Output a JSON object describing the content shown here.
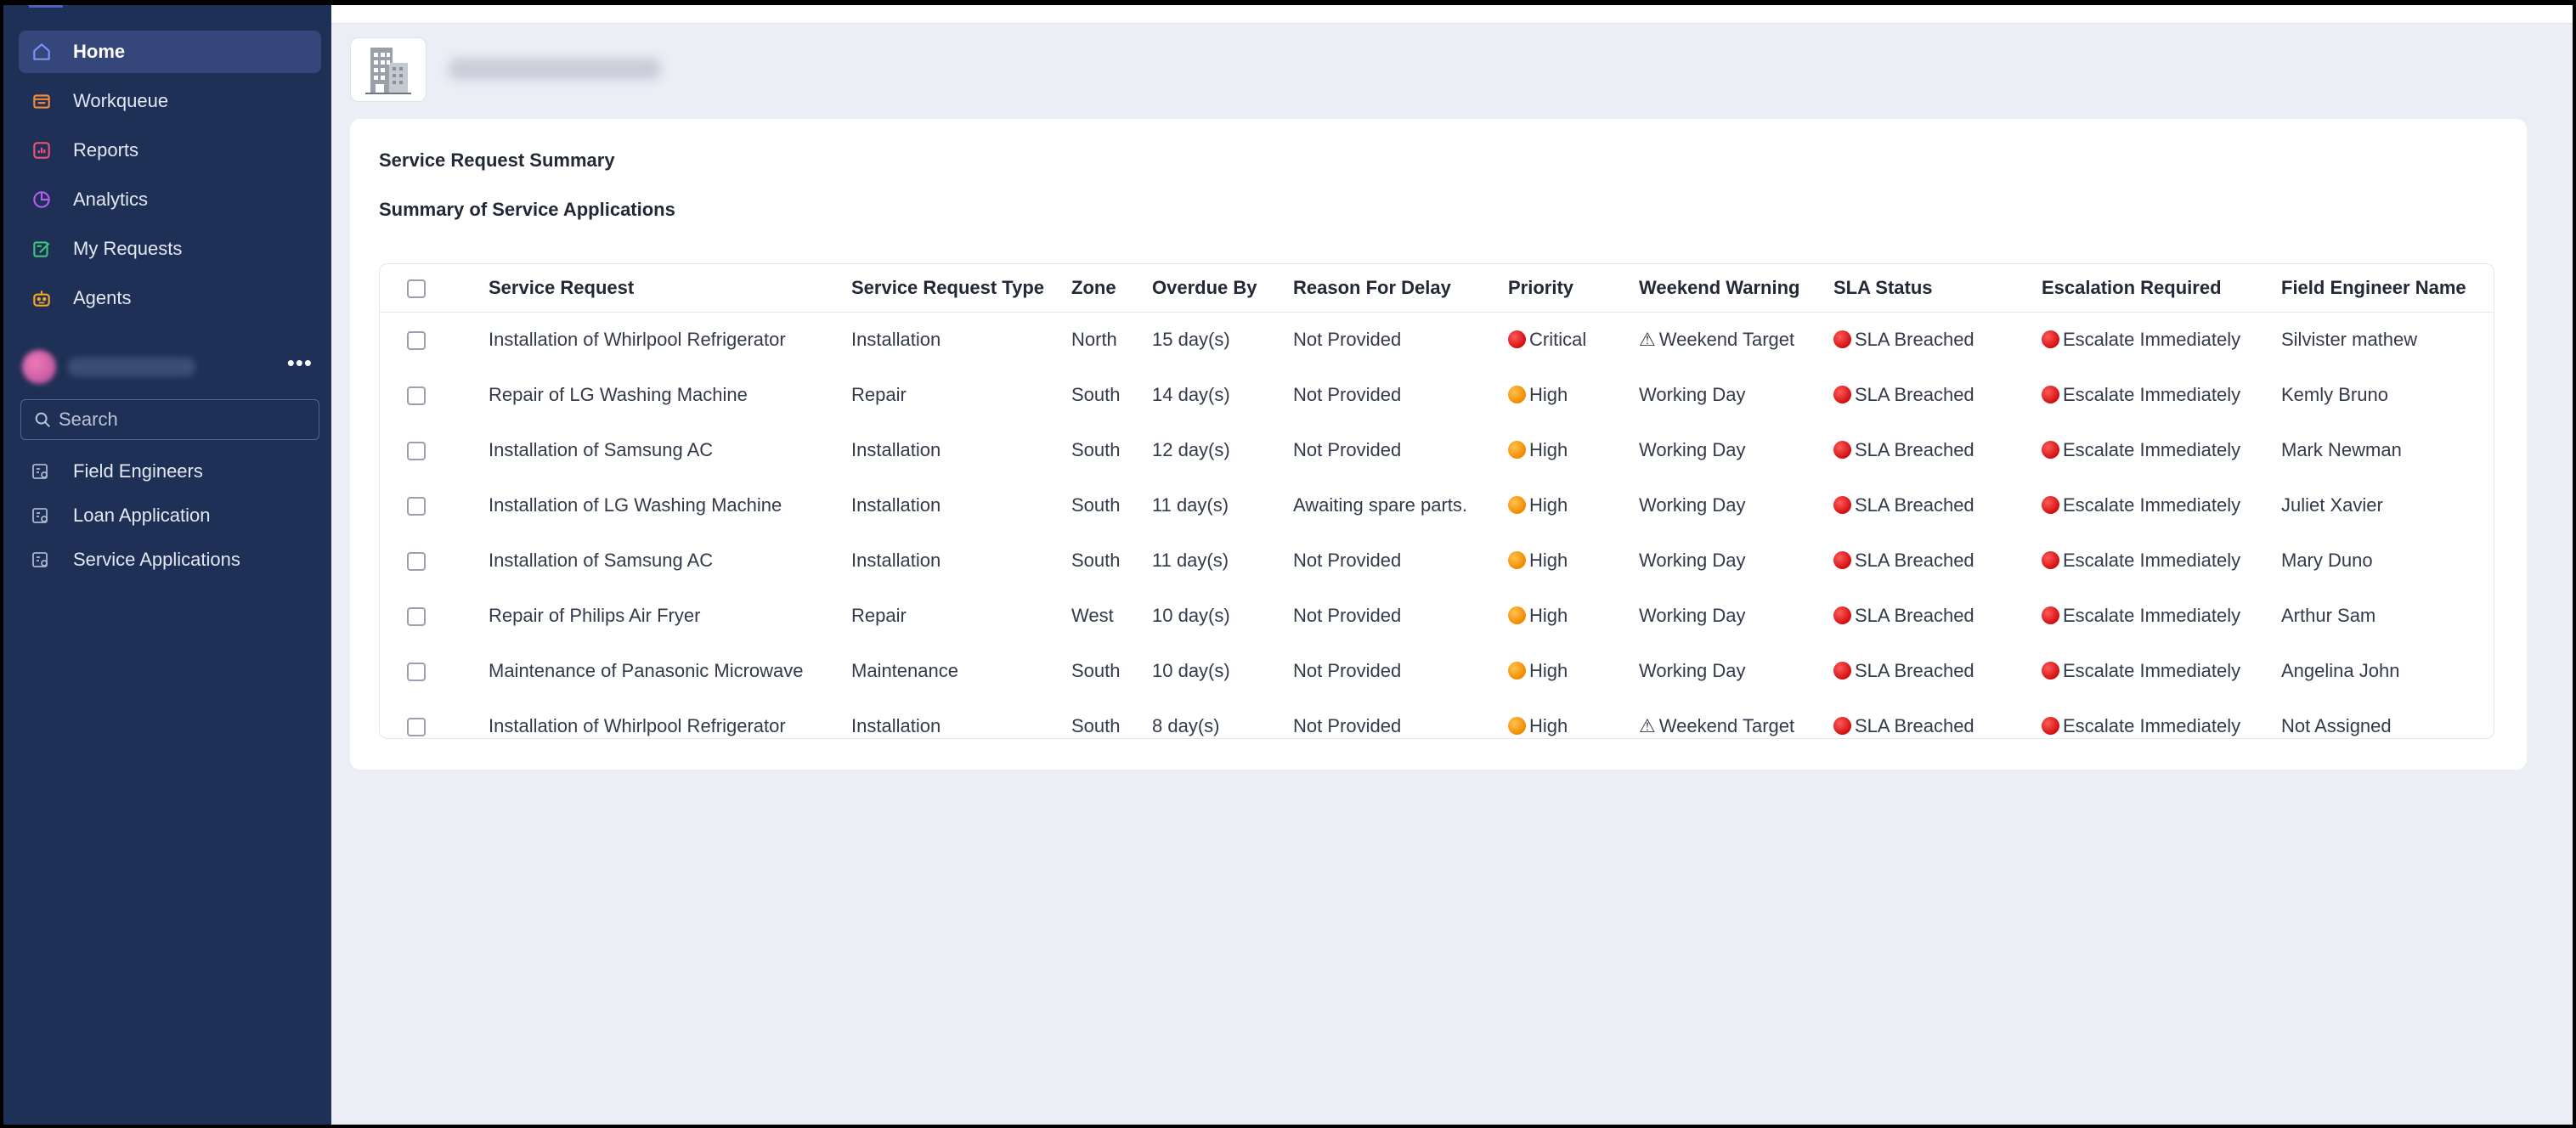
{
  "sidebar": {
    "nav": [
      {
        "label": "Home",
        "icon": "home-icon",
        "color": "#7b93f5",
        "active": true
      },
      {
        "label": "Workqueue",
        "icon": "workqueue-icon",
        "color": "#f08a3c"
      },
      {
        "label": "Reports",
        "icon": "reports-icon",
        "color": "#f04f7a"
      },
      {
        "label": "Analytics",
        "icon": "analytics-icon",
        "color": "#b45cf2"
      },
      {
        "label": "My Requests",
        "icon": "my-requests-icon",
        "color": "#3cc37a"
      },
      {
        "label": "Agents",
        "icon": "agents-icon",
        "color": "#f5a623"
      }
    ],
    "more_label": "•••",
    "search": {
      "placeholder": "Search"
    },
    "pages": [
      {
        "label": "Field Engineers"
      },
      {
        "label": "Loan Application"
      },
      {
        "label": "Service Applications"
      }
    ]
  },
  "main": {
    "card_title": "Service Request Summary",
    "card_subtitle": "Summary of Service Applications",
    "table": {
      "columns": [
        "Service Request",
        "Service Request Type",
        "Zone",
        "Overdue By",
        "Reason For Delay",
        "Priority",
        "Weekend Warning",
        "SLA Status",
        "Escalation Required",
        "Field Engineer Name"
      ],
      "rows": [
        {
          "request": "Installation of Whirlpool Refrigerator",
          "type": "Installation",
          "zone": "North",
          "overdue": "15 day(s)",
          "reason": "Not Provided",
          "priority": "Critical",
          "priority_level": "red",
          "weekend": "Weekend Target",
          "weekend_warn": true,
          "sla": "SLA Breached",
          "escalation": "Escalate Immediately",
          "engineer": "Silvister mathew"
        },
        {
          "request": "Repair of LG Washing Machine",
          "type": "Repair",
          "zone": "South",
          "overdue": "14 day(s)",
          "reason": "Not Provided",
          "priority": "High",
          "priority_level": "orange",
          "weekend": "Working Day",
          "weekend_warn": false,
          "sla": "SLA Breached",
          "escalation": "Escalate Immediately",
          "engineer": "Kemly Bruno"
        },
        {
          "request": "Installation of Samsung AC",
          "type": "Installation",
          "zone": "South",
          "overdue": "12 day(s)",
          "reason": "Not Provided",
          "priority": "High",
          "priority_level": "orange",
          "weekend": "Working Day",
          "weekend_warn": false,
          "sla": "SLA Breached",
          "escalation": "Escalate Immediately",
          "engineer": "Mark Newman"
        },
        {
          "request": "Installation of LG Washing Machine",
          "type": "Installation",
          "zone": "South",
          "overdue": "11 day(s)",
          "reason": "Awaiting spare parts.",
          "priority": "High",
          "priority_level": "orange",
          "weekend": "Working Day",
          "weekend_warn": false,
          "sla": "SLA Breached",
          "escalation": "Escalate Immediately",
          "engineer": "Juliet Xavier"
        },
        {
          "request": "Installation of Samsung AC",
          "type": "Installation",
          "zone": "South",
          "overdue": "11 day(s)",
          "reason": "Not Provided",
          "priority": "High",
          "priority_level": "orange",
          "weekend": "Working Day",
          "weekend_warn": false,
          "sla": "SLA Breached",
          "escalation": "Escalate Immediately",
          "engineer": "Mary Duno"
        },
        {
          "request": "Repair of Philips Air Fryer",
          "type": "Repair",
          "zone": "West",
          "overdue": "10 day(s)",
          "reason": "Not Provided",
          "priority": "High",
          "priority_level": "orange",
          "weekend": "Working Day",
          "weekend_warn": false,
          "sla": "SLA Breached",
          "escalation": "Escalate Immediately",
          "engineer": "Arthur Sam"
        },
        {
          "request": "Maintenance of Panasonic Microwave",
          "type": "Maintenance",
          "zone": "South",
          "overdue": "10 day(s)",
          "reason": "Not Provided",
          "priority": "High",
          "priority_level": "orange",
          "weekend": "Working Day",
          "weekend_warn": false,
          "sla": "SLA Breached",
          "escalation": "Escalate Immediately",
          "engineer": "Angelina John"
        },
        {
          "request": "Installation of Whirlpool Refrigerator",
          "type": "Installation",
          "zone": "South",
          "overdue": "8 day(s)",
          "reason": "Not Provided",
          "priority": "High",
          "priority_level": "orange",
          "weekend": "Weekend Target",
          "weekend_warn": true,
          "sla": "SLA Breached",
          "escalation": "Escalate Immediately",
          "engineer": "Not Assigned"
        }
      ]
    }
  }
}
